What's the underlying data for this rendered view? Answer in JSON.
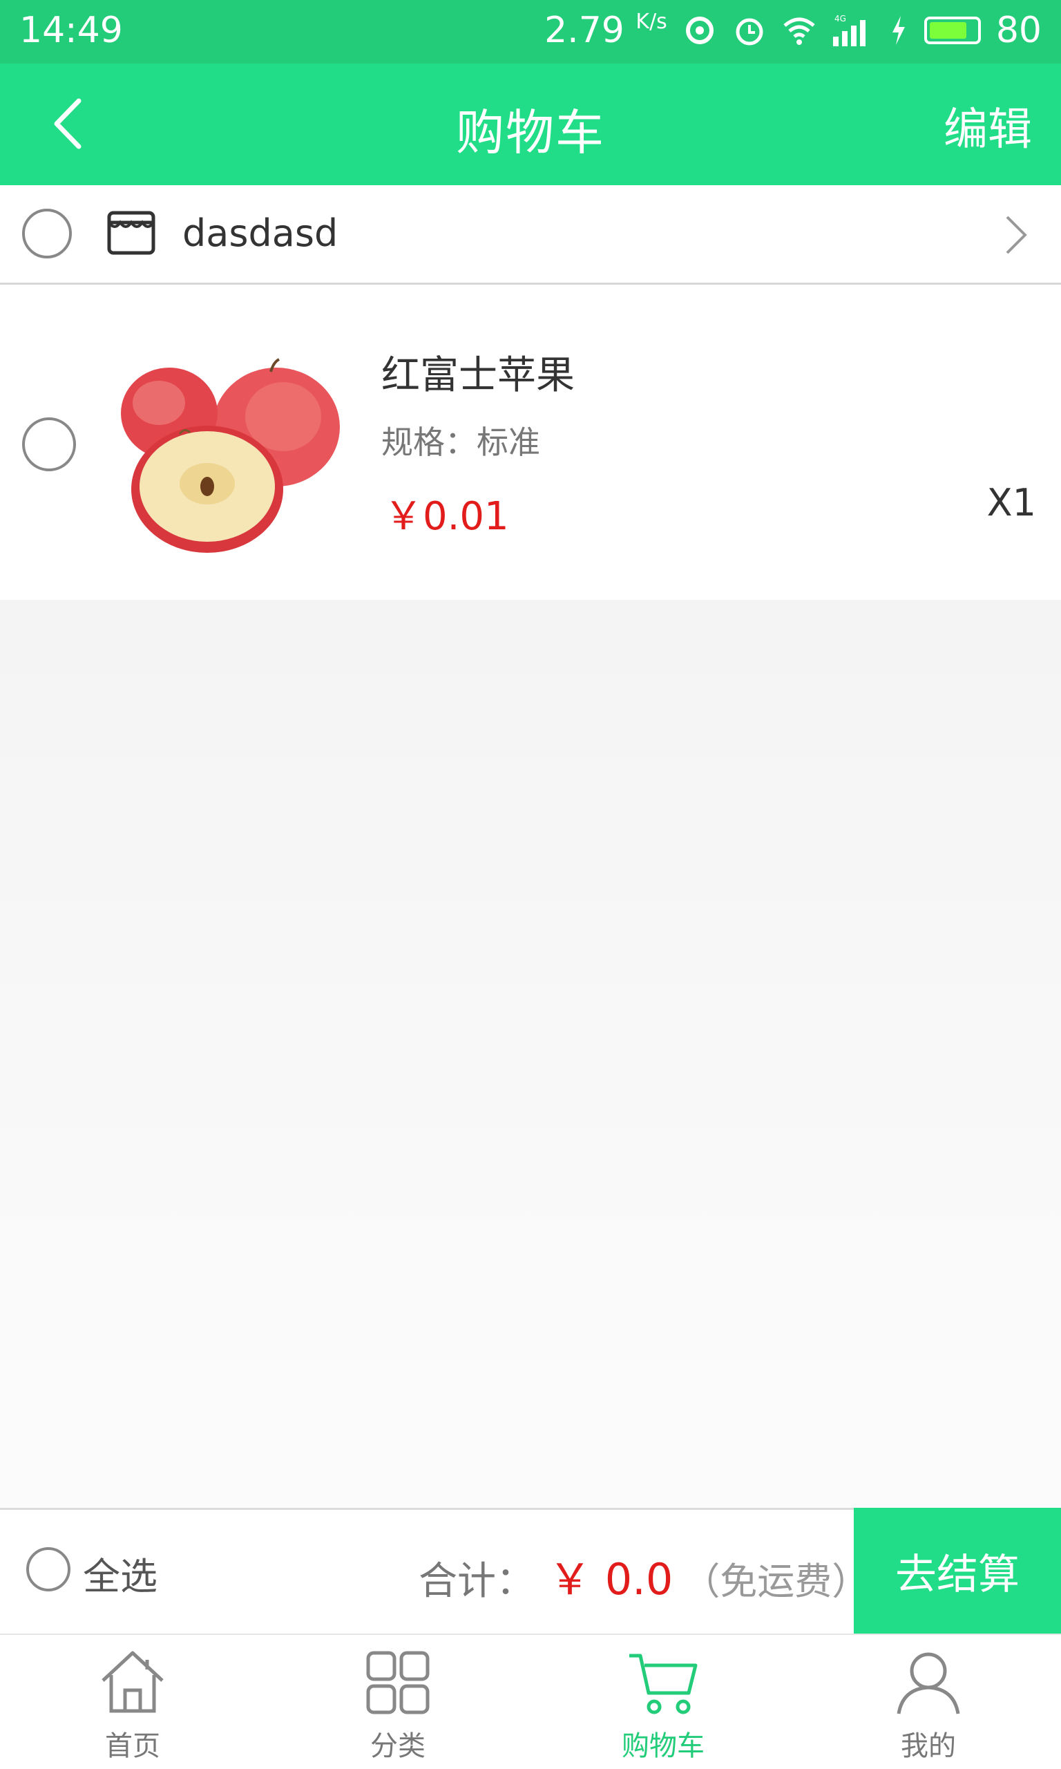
{
  "status_bar": {
    "time": "14:49",
    "network_speed": "2.79",
    "network_unit": "K/s",
    "battery_level": "80",
    "icons": [
      "sync-icon",
      "alarm-icon",
      "wifi-icon",
      "signal-4g-icon",
      "charging-icon",
      "battery-icon"
    ]
  },
  "header": {
    "title": "购物车",
    "edit_label": "编辑",
    "back_icon": "chevron-left-icon"
  },
  "shop": {
    "name": "dasdasd",
    "icon": "store-icon"
  },
  "cart_items": [
    {
      "name": "红富士苹果",
      "spec": "规格：标准",
      "price": "￥0.01",
      "quantity": "X1"
    }
  ],
  "checkout": {
    "select_all_label": "全选",
    "total_label": "合计：",
    "total_amount": "￥ 0.0",
    "shipping_note": "（免运费）",
    "button_label": "去结算"
  },
  "tabbar": {
    "items": [
      {
        "label": "首页",
        "icon": "home-icon"
      },
      {
        "label": "分类",
        "icon": "grid-icon"
      },
      {
        "label": "购物车",
        "icon": "cart-icon"
      },
      {
        "label": "我的",
        "icon": "user-icon"
      }
    ],
    "active_index": 2
  },
  "colors": {
    "accent": "#22dd88",
    "price": "#e21b1b"
  }
}
